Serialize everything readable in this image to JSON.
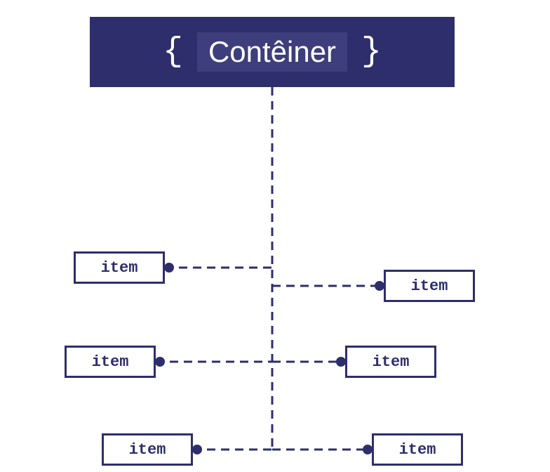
{
  "container": {
    "label": "Contêiner",
    "brace_left": "{",
    "brace_right": "}"
  },
  "items": {
    "left": [
      "item",
      "item",
      "item"
    ],
    "right": [
      "item",
      "item",
      "item"
    ]
  },
  "colors": {
    "primary": "#2d2e6b",
    "highlight": "#3d3e7b",
    "text": "#ffffff"
  }
}
